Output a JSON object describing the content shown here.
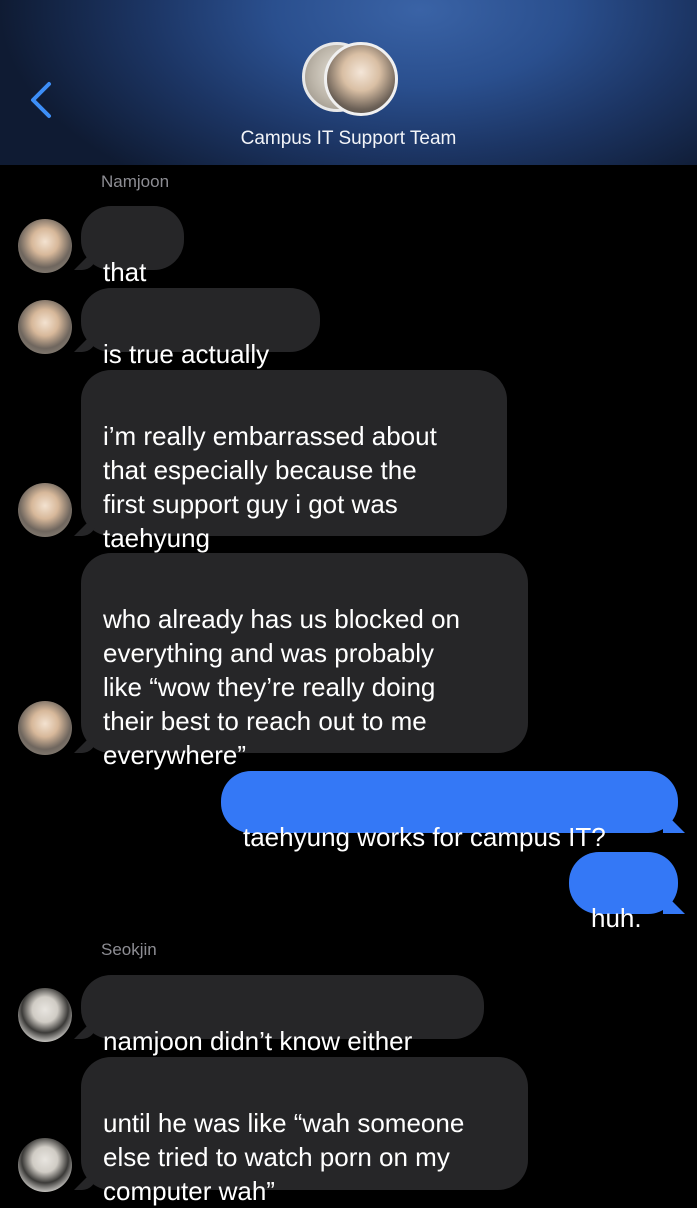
{
  "header": {
    "title": "Campus IT Support Team",
    "back_icon": "chevron-left-icon",
    "accent_color": "#3478f6"
  },
  "messages": [
    {
      "sender": "Namjoon",
      "text": "that",
      "direction": "incoming"
    },
    {
      "text": "is true actually",
      "direction": "incoming"
    },
    {
      "text": "i’m really embarrassed about\nthat especially because the\nfirst support guy i got was\ntaehyung",
      "direction": "incoming"
    },
    {
      "text": "who already has us blocked on\neverything and was probably\nlike “wow they’re really doing\ntheir best to reach out to me\neverywhere”",
      "direction": "incoming"
    },
    {
      "text": "taehyung works for campus IT?",
      "direction": "outgoing"
    },
    {
      "text": "huh.",
      "direction": "outgoing"
    },
    {
      "sender": "Seokjin",
      "text": "namjoon didn’t know either",
      "direction": "incoming"
    },
    {
      "text": "until he was like “wah someone\nelse tried to watch porn on my\ncomputer wah”",
      "direction": "incoming"
    }
  ],
  "colors": {
    "incoming_bubble": "#262628",
    "outgoing_bubble": "#3478f6",
    "sender_label": "#8d8d93"
  }
}
